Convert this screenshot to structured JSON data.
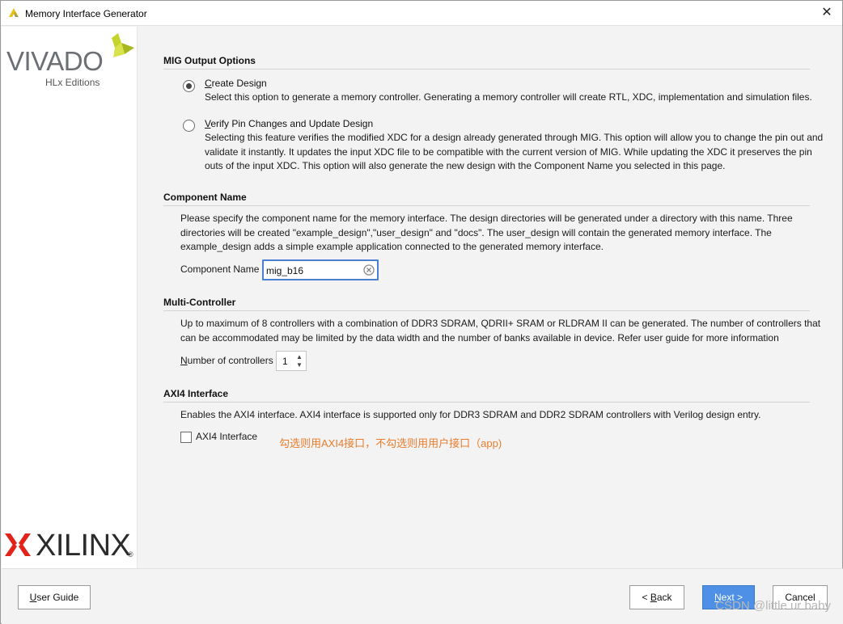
{
  "window": {
    "title": "Memory Interface Generator",
    "close_glyph": "✕",
    "icon": "vivado-app-icon"
  },
  "branding": {
    "vivado_word": "VIVADO",
    "vivado_sub": "HLx Editions",
    "xilinx_word": "XILINX",
    "xilinx_reg": "®"
  },
  "sections": {
    "mig_output": {
      "title": "MIG Output Options",
      "options": [
        {
          "label_key": "C",
          "label_rest": "reate Design",
          "description": "Select this option to generate a memory controller. Generating a memory controller will create RTL, XDC, implementation and simulation files.",
          "selected": true
        },
        {
          "label_key": "V",
          "label_rest": "erify Pin Changes and Update Design",
          "description_lines": [
            "Selecting this feature verifies the modified XDC for a design already generated through MIG. This option will allow you to change the pin out and",
            "validate it instantly. It updates the input XDC file to be compatible with the current version of MIG. While updating the XDC it preserves the pin",
            "outs of the input XDC. This option will also generate the new design with the Component Name you selected in this page."
          ],
          "selected": false
        }
      ]
    },
    "component_name": {
      "title": "Component Name",
      "description_lines": [
        "Please specify the component name for the memory interface. The design directories will be generated under a directory with this name. Three",
        "directories will be created \"example_design\",\"user_design\" and \"docs\". The user_design will contain the generated memory interface. The",
        "example_design adds a simple example application connected to the generated memory interface."
      ],
      "field_label": "Component Name",
      "field_value": "mig_b16"
    },
    "multi_controller": {
      "title": "Multi-Controller",
      "description_lines": [
        "Up to maximum of 8 controllers with a combination of DDR3 SDRAM, QDRII+ SRAM or RLDRAM II can be generated. The number of controllers that",
        "can be accommodated may be limited by the data width and the number of banks available in device. Refer user guide for more information"
      ],
      "field_label_key": "N",
      "field_label_rest": "umber of controllers",
      "field_value": "1"
    },
    "axi4": {
      "title": "AXI4 Interface",
      "description": "Enables the AXI4 interface. AXI4 interface is supported only for DDR3 SDRAM and DDR2 SDRAM controllers with Verilog design entry.",
      "checkbox_label": "AXI4 Interface",
      "checked": false,
      "annotation": "勾选则用AXI4接口，不勾选则用用户接口（app)",
      "annotation_color": "#e87c2c"
    }
  },
  "footer": {
    "user_guide_key": "U",
    "user_guide_rest": "ser Guide",
    "back_prefix": "< ",
    "back_key": "B",
    "back_rest": "ack",
    "next_key": "N",
    "next_rest": "ext >",
    "cancel": "Cancel",
    "accent": "#4d90e6"
  },
  "watermark": "CSDN @little ur baby"
}
